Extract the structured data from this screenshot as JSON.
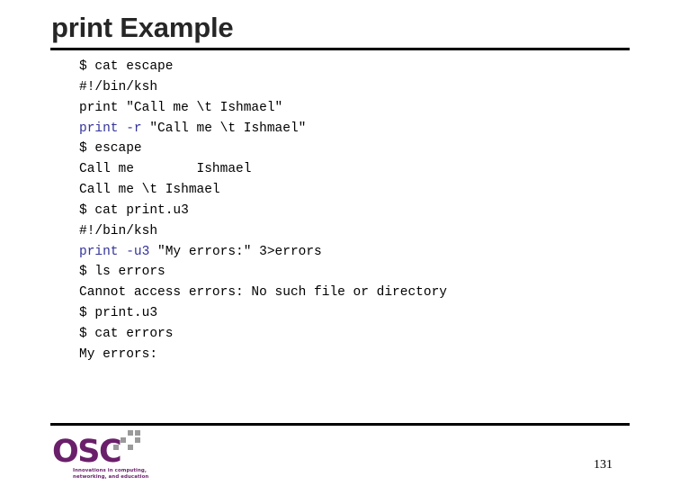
{
  "slide": {
    "title": "print Example",
    "page_number": "131",
    "colors": {
      "title": "#262626",
      "rule": "#000000",
      "code_default": "#000000",
      "code_keyword": "#33339a",
      "logo_purple": "#6a1f6a",
      "logo_checker_gray": "#9a9a9a",
      "background": "#ffffff"
    }
  },
  "code": {
    "lines": [
      {
        "id": "line-1",
        "text": "$ cat escape",
        "keyword": ""
      },
      {
        "id": "line-2",
        "text": "#!/bin/ksh",
        "keyword": ""
      },
      {
        "id": "line-3",
        "text": "print \"Call me \\t Ishmael\"",
        "keyword": ""
      },
      {
        "id": "line-4",
        "text": "print -r \"Call me \\t Ishmael\"",
        "keyword": "print -r"
      },
      {
        "id": "line-5",
        "text": "$ escape",
        "keyword": ""
      },
      {
        "id": "line-6",
        "text": "Call me        Ishmael",
        "keyword": ""
      },
      {
        "id": "line-7",
        "text": "Call me \\t Ishmael",
        "keyword": ""
      },
      {
        "id": "line-8",
        "text": "$ cat print.u3",
        "keyword": ""
      },
      {
        "id": "line-9",
        "text": "#!/bin/ksh",
        "keyword": ""
      },
      {
        "id": "line-10",
        "text": "print -u3 \"My errors:\" 3>errors",
        "keyword": "print -u3"
      },
      {
        "id": "line-11",
        "text": "$ ls errors",
        "keyword": ""
      },
      {
        "id": "line-12",
        "text": "Cannot access errors: No such file or directory",
        "keyword": ""
      },
      {
        "id": "line-13",
        "text": "$ print.u3",
        "keyword": ""
      },
      {
        "id": "line-14",
        "text": "$ cat errors",
        "keyword": ""
      },
      {
        "id": "line-15",
        "text": "My errors:",
        "keyword": ""
      }
    ]
  },
  "logo": {
    "wordmark": "OSC",
    "tagline": "Innovations in computing, networking, and education"
  }
}
